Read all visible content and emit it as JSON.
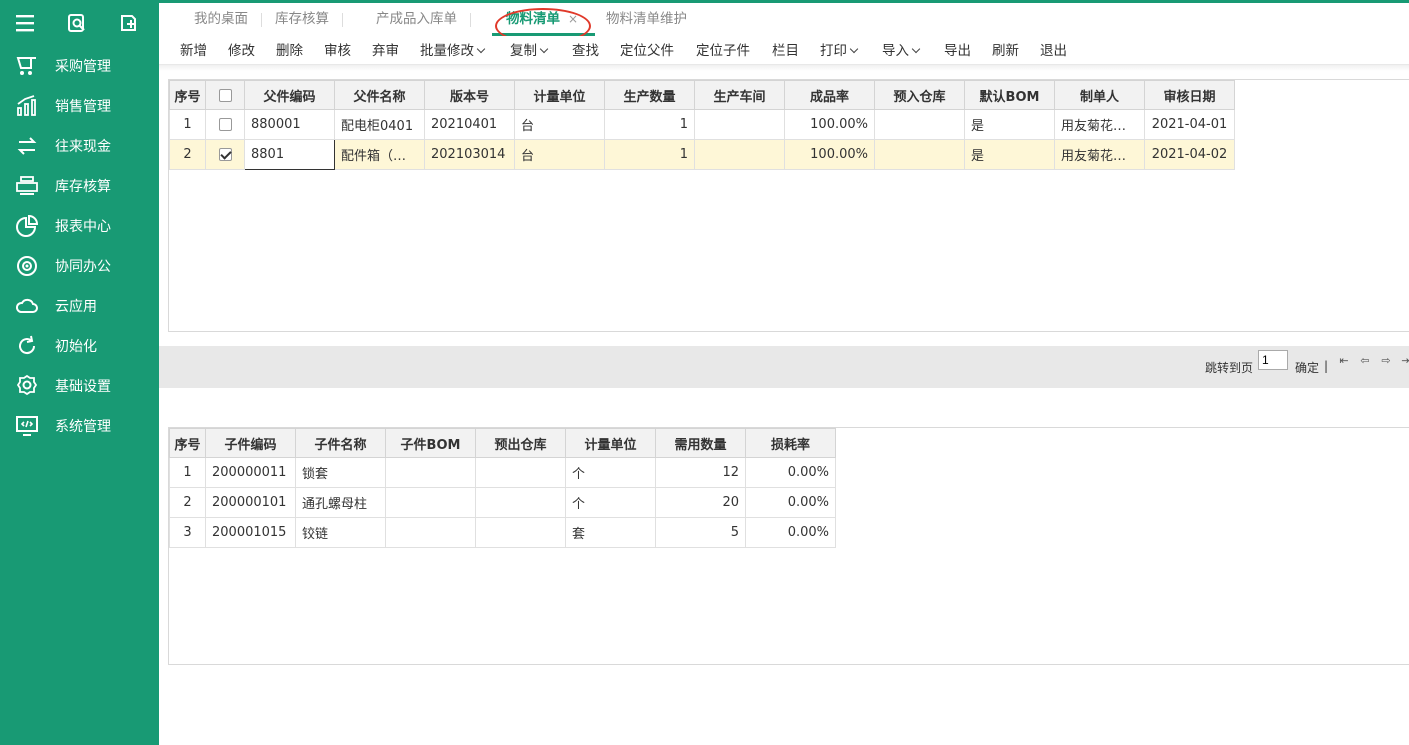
{
  "sidebar": {
    "top_icons": [
      "menu-icon",
      "search-doc-icon",
      "add-doc-icon"
    ],
    "items": [
      {
        "label": "采购管理",
        "icon": "cart-icon"
      },
      {
        "label": "销售管理",
        "icon": "chart-icon"
      },
      {
        "label": "往来现金",
        "icon": "exchange-icon"
      },
      {
        "label": "库存核算",
        "icon": "printer-icon"
      },
      {
        "label": "报表中心",
        "icon": "pie-icon"
      },
      {
        "label": "协同办公",
        "icon": "collab-icon"
      },
      {
        "label": "云应用",
        "icon": "cloud-icon"
      },
      {
        "label": "初始化",
        "icon": "refresh-icon"
      },
      {
        "label": "基础设置",
        "icon": "settings-icon"
      },
      {
        "label": "系统管理",
        "icon": "monitor-icon"
      }
    ]
  },
  "tabs": [
    {
      "label": "我的桌面"
    },
    {
      "label": "库存核算"
    },
    {
      "label": "产成品入库单"
    },
    {
      "label": "物料清单",
      "close": "×"
    },
    {
      "label": "物料清单维护"
    }
  ],
  "toolbar": [
    "新增",
    "修改",
    "删除",
    "审核",
    "弃审",
    "批量修改",
    "复制",
    "查找",
    "定位父件",
    "定位子件",
    "栏目",
    "打印",
    "导入",
    "导出",
    "刷新",
    "退出"
  ],
  "master": {
    "headers": [
      "序号",
      "",
      "父件编码",
      "父件名称",
      "版本号",
      "计量单位",
      "生产数量",
      "生产车间",
      "成品率",
      "预入仓库",
      "默认BOM",
      "制单人",
      "审核日期"
    ],
    "rows": [
      {
        "no": "1",
        "checked": false,
        "code": "880001",
        "name": "配电柜0401",
        "ver": "20210401",
        "unit": "台",
        "qty": "1",
        "shop": "",
        "rate": "100.00%",
        "wh": "",
        "def": "是",
        "maker": "用友菊花…",
        "date": "2021-04-01"
      },
      {
        "no": "2",
        "checked": true,
        "code": "8801",
        "name": "配件箱（…",
        "ver": "202103014",
        "unit": "台",
        "qty": "1",
        "shop": "",
        "rate": "100.00%",
        "wh": "",
        "def": "是",
        "maker": "用友菊花…",
        "date": "2021-04-02"
      }
    ]
  },
  "pager": {
    "jump_label": "跳转到页",
    "page_value": "1",
    "confirm": "确定",
    "sep": "|"
  },
  "detail": {
    "headers": [
      "序号",
      "子件编码",
      "子件名称",
      "子件BOM",
      "预出仓库",
      "计量单位",
      "需用数量",
      "损耗率"
    ],
    "rows": [
      {
        "no": "1",
        "code": "200000011",
        "name": "锁套",
        "bom": "",
        "wh": "",
        "unit": "个",
        "qty": "12",
        "loss": "0.00%"
      },
      {
        "no": "2",
        "code": "200000101",
        "name": "通孔螺母柱",
        "bom": "",
        "wh": "",
        "unit": "个",
        "qty": "20",
        "loss": "0.00%"
      },
      {
        "no": "3",
        "code": "200001015",
        "name": "铰链",
        "bom": "",
        "wh": "",
        "unit": "套",
        "qty": "5",
        "loss": "0.00%"
      }
    ]
  },
  "colors": {
    "brand": "#189a74",
    "selected_row": "#fef7d7",
    "annotation": "#e0392a"
  }
}
